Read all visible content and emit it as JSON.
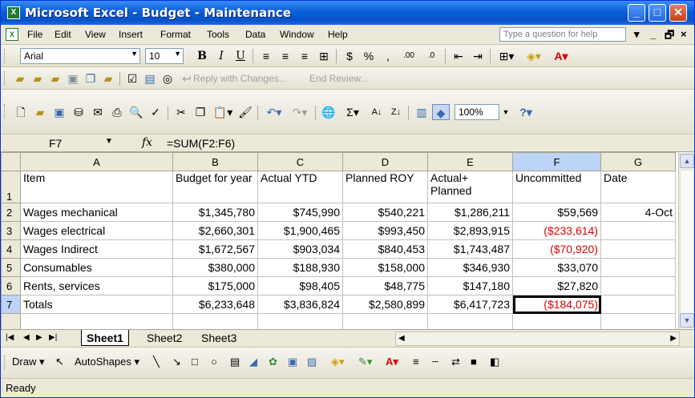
{
  "window": {
    "title": "Microsoft Excel - Budget - Maintenance",
    "minimize_label": "_",
    "maximize_label": "□",
    "close_label": "✕",
    "app_icon_label": "X"
  },
  "menubar": {
    "items": [
      "File",
      "Edit",
      "View",
      "Insert",
      "Format",
      "Tools",
      "Data",
      "Window",
      "Help"
    ],
    "ask_placeholder": "Type a question for help",
    "ask_arrow": "▾",
    "doc_minimize": "_",
    "doc_restore": "🗗",
    "doc_close": "×"
  },
  "formatting_toolbar": {
    "font": "Arial",
    "size": "10",
    "bold": "B",
    "italic": "I",
    "underline": "U",
    "currency": "$",
    "percent": "%",
    "comma": ",",
    "inc_decimal": ".00",
    "dec_decimal": ".0"
  },
  "reviewing_toolbar": {
    "reply_label": "Reply with Changes...",
    "end_review_label": "End Review..."
  },
  "standard_toolbar": {
    "zoom": "100%",
    "sum_symbol": "Σ",
    "help_symbol": "?"
  },
  "formula_bar": {
    "cell_ref": "F7",
    "fx": "fx",
    "formula": "=SUM(F2:F6)"
  },
  "sheet": {
    "columns": [
      "A",
      "B",
      "C",
      "D",
      "E",
      "F",
      "G"
    ],
    "selected_column": "F",
    "active_cell": "F7",
    "header_row": {
      "row": "1",
      "cells": [
        "Item",
        "Budget for year",
        "Actual YTD",
        "Planned ROY",
        "Actual+ Planned",
        "Uncommitted",
        "Date"
      ]
    },
    "rows": [
      {
        "row": "2",
        "item": "Wages mechanical",
        "budget": "$1,345,780",
        "actual": "$745,990",
        "planned": "$540,221",
        "actual_planned": "$1,286,211",
        "uncommitted": "$59,569",
        "date": "4-Oct",
        "negative": false
      },
      {
        "row": "3",
        "item": "Wages electrical",
        "budget": "$2,660,301",
        "actual": "$1,900,465",
        "planned": "$993,450",
        "actual_planned": "$2,893,915",
        "uncommitted": "($233,614)",
        "date": "",
        "negative": true
      },
      {
        "row": "4",
        "item": "Wages Indirect",
        "budget": "$1,672,567",
        "actual": "$903,034",
        "planned": "$840,453",
        "actual_planned": "$1,743,487",
        "uncommitted": "($70,920)",
        "date": "",
        "negative": true
      },
      {
        "row": "5",
        "item": "Consumables",
        "budget": "$380,000",
        "actual": "$188,930",
        "planned": "$158,000",
        "actual_planned": "$346,930",
        "uncommitted": "$33,070",
        "date": "",
        "negative": false
      },
      {
        "row": "6",
        "item": "Rents, services",
        "budget": "$175,000",
        "actual": "$98,405",
        "planned": "$48,775",
        "actual_planned": "$147,180",
        "uncommitted": "$27,820",
        "date": "",
        "negative": false
      },
      {
        "row": "7",
        "item": "Totals",
        "budget": "$6,233,648",
        "actual": "$3,836,824",
        "planned": "$2,580,899",
        "actual_planned": "$6,417,723",
        "uncommitted": "($184,075)",
        "date": "",
        "negative": true
      }
    ]
  },
  "tabs": {
    "sheets": [
      "Sheet1",
      "Sheet2",
      "Sheet3"
    ],
    "active": "Sheet1"
  },
  "drawing_toolbar": {
    "draw_label": "Draw",
    "autoshapes_label": "AutoShapes"
  },
  "status": {
    "text": "Ready"
  },
  "colors": {
    "negative": "#e00000",
    "titlebar": "#0a5fd8",
    "selected_header": "#bcd4f6"
  }
}
